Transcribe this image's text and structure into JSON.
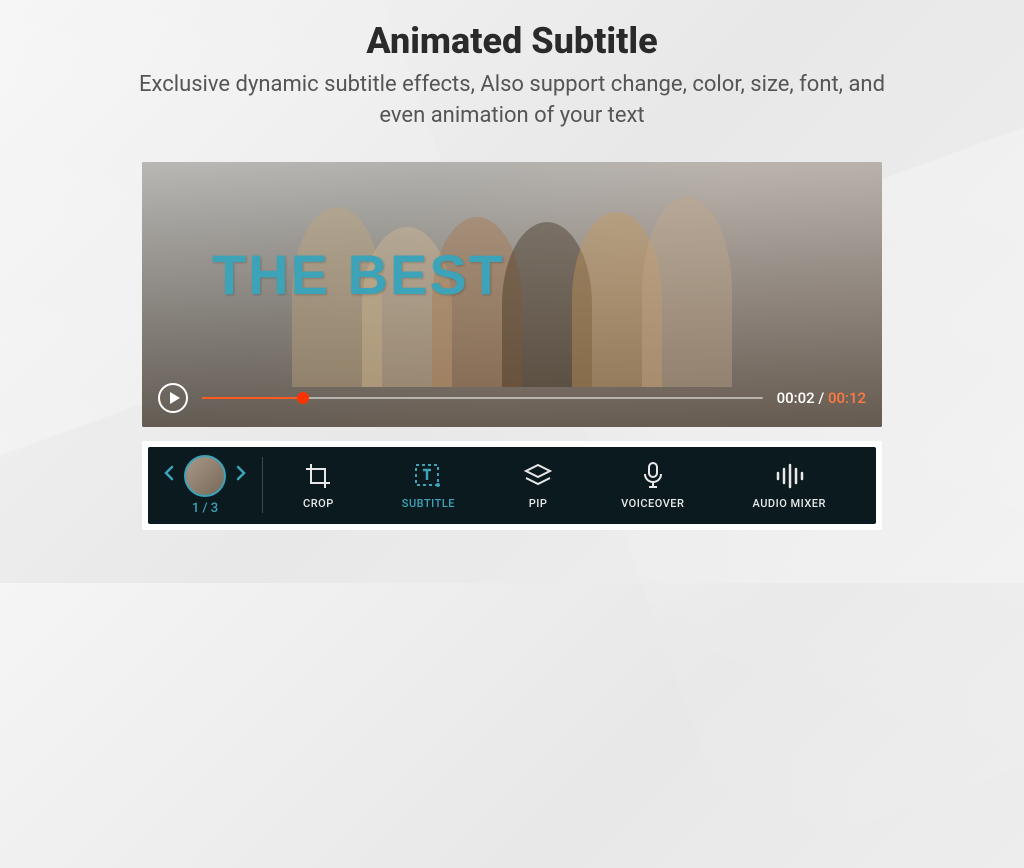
{
  "header": {
    "title": "Animated Subtitle",
    "subtitle": "Exclusive dynamic subtitle effects, Also support change, color, size, font, and even animation of your text"
  },
  "player": {
    "overlay_text": "THE BEST",
    "current_time": "00:02",
    "total_time": "00:12",
    "time_separator": " / "
  },
  "clip_nav": {
    "counter": "1 / 3"
  },
  "tools": [
    {
      "name": "crop",
      "label": "CROP",
      "icon": "crop",
      "active": false
    },
    {
      "name": "subtitle",
      "label": "SUBTITLE",
      "icon": "subtitle",
      "active": true
    },
    {
      "name": "pip",
      "label": "PIP",
      "icon": "layers",
      "active": false
    },
    {
      "name": "voiceover",
      "label": "VOICEOVER",
      "icon": "mic",
      "active": false
    },
    {
      "name": "audio-mixer",
      "label": "AUDIO MIXER",
      "icon": "equalizer",
      "active": false
    }
  ]
}
